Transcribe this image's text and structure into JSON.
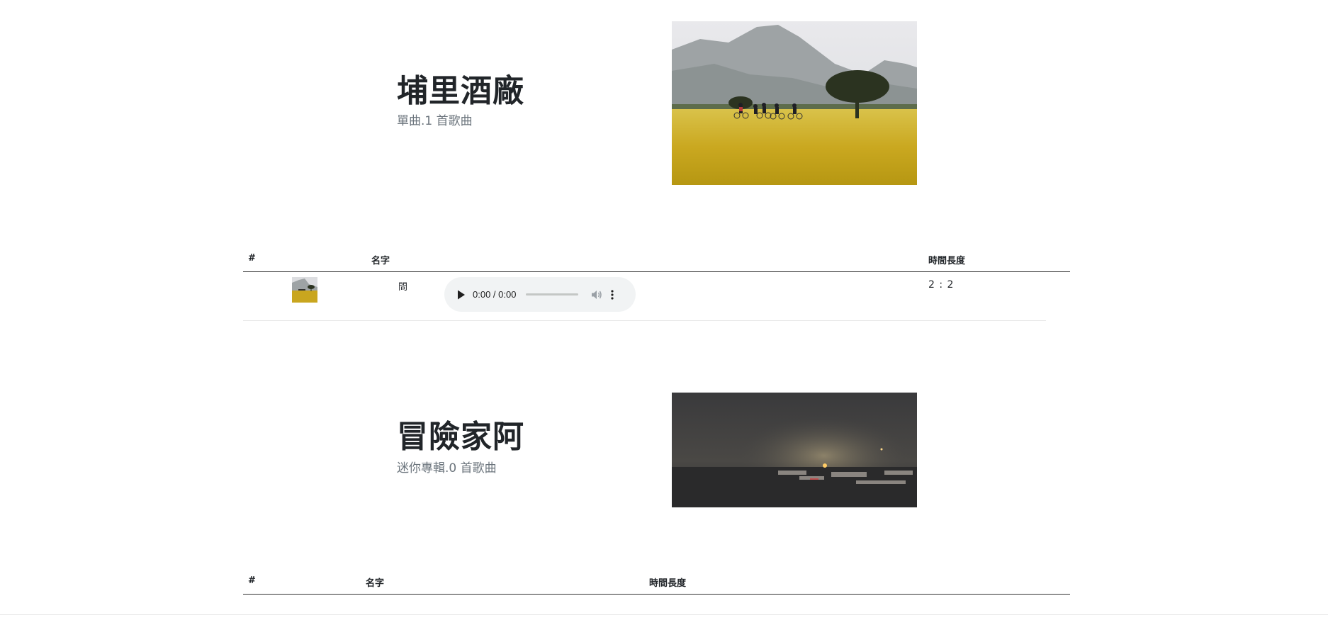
{
  "albums": [
    {
      "title": "埔里酒廠",
      "subtitle": "單曲.1 首歌曲",
      "cover": "rice-field-cyclists-photo",
      "table_headers": {
        "index": "#",
        "name": "名字",
        "duration": "時間長度"
      },
      "tracks": [
        {
          "index": "",
          "name": "問",
          "thumbnail": "rice-field-cyclists-photo",
          "player": {
            "current_time": "0:00",
            "separator": " / ",
            "total_time": "0:00"
          },
          "duration": "2 : 2"
        }
      ]
    },
    {
      "title": "冒險家阿",
      "subtitle": "迷你專輯.0 首歌曲",
      "cover": "night-harbor-photo",
      "table_headers": {
        "index": "#",
        "name": "名字",
        "duration": "時間長度"
      },
      "tracks": []
    }
  ],
  "icons": {
    "play": "play-icon",
    "volume": "volume-icon",
    "more": "more-vertical-icon"
  }
}
